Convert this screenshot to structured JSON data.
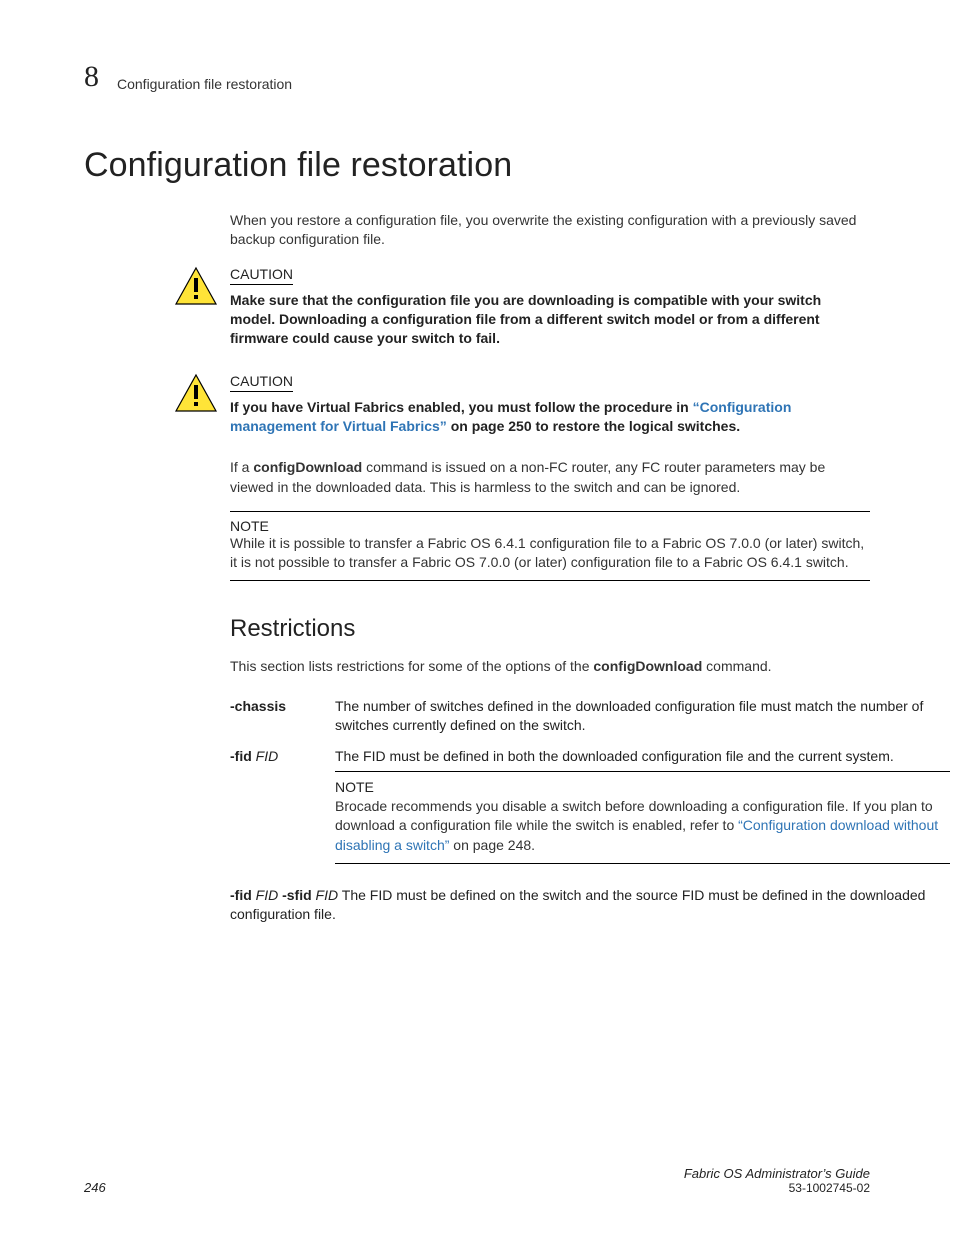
{
  "header": {
    "chapter_number": "8",
    "running_title": "Configuration file restoration"
  },
  "title": "Configuration file restoration",
  "intro": "When you restore a configuration file, you overwrite the existing configuration with a previously saved backup configuration file.",
  "caution1": {
    "label": "CAUTION",
    "text": "Make sure that the configuration file you are downloading is compatible with your switch model. Downloading a configuration file from a different switch model or from a different firmware could cause your switch to fail."
  },
  "caution2": {
    "label": "CAUTION",
    "pre": "If you have Virtual Fabrics enabled, you must follow the procedure in ",
    "link": "“Configuration management for Virtual Fabrics”",
    "post": " on page 250 to restore the logical switches."
  },
  "para_router_pre": "If a ",
  "para_router_bold": "configDownload",
  "para_router_post": " command is issued on a non-FC router, any FC router parameters may be viewed in the downloaded data. This is harmless to the switch and can be ignored.",
  "note1": {
    "label": "NOTE",
    "text": "While it is possible to transfer a Fabric OS 6.4.1 configuration file to a Fabric OS 7.0.0 (or later) switch, it is not possible to transfer a Fabric OS 7.0.0 (or later) configuration file to a Fabric OS 6.4.1 switch."
  },
  "restrictions": {
    "heading": "Restrictions",
    "intro_pre": "This section lists restrictions for some of the options of the ",
    "intro_bold": "configDownload",
    "intro_post": " command.",
    "rows": [
      {
        "term_bold": "-chassis",
        "term_ital": "",
        "desc": "The number of switches defined in the downloaded configuration file must match the number of switches currently defined on the switch."
      },
      {
        "term_bold": "-fid",
        "term_ital": " FID",
        "desc": "The FID must be defined in both the downloaded configuration file and the current system."
      }
    ],
    "note": {
      "label": "NOTE",
      "pre": "Brocade recommends you disable a switch before downloading a configuration file. If you plan to download a configuration file while the switch is enabled, refer to ",
      "link": "“Configuration download without disabling a switch”",
      "post": " on page 248."
    },
    "row3": {
      "term_b1": "-fid",
      "term_i1": " FID ",
      "term_b2": "-sfid",
      "term_i2": " FID",
      "desc": " The FID must be defined on the switch and the source FID must be defined in the downloaded configuration file."
    }
  },
  "footer": {
    "page": "246",
    "doc_title": "Fabric OS Administrator’s Guide",
    "doc_id": "53-1002745-02"
  }
}
